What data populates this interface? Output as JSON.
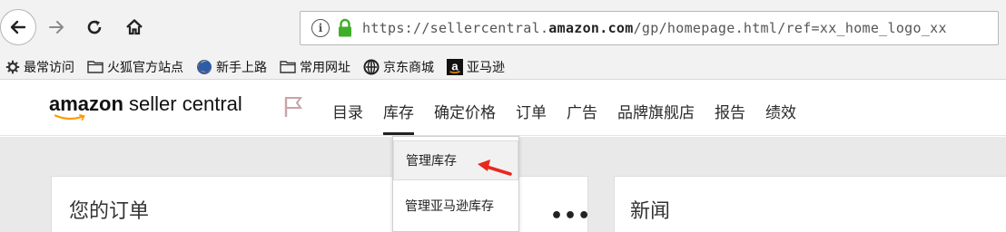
{
  "browser": {
    "url_prefix": "https://sellercentral.",
    "url_domain": "amazon.com",
    "url_suffix": "/gp/homepage.html/ref=xx_home_logo_xx"
  },
  "bookmarks": [
    {
      "label": "最常访问",
      "icon": "gear-icon"
    },
    {
      "label": "火狐官方站点",
      "icon": "folder-icon"
    },
    {
      "label": "新手上路",
      "icon": "firefox-icon"
    },
    {
      "label": "常用网址",
      "icon": "folder-icon"
    },
    {
      "label": "京东商城",
      "icon": "jd-icon"
    },
    {
      "label": "亚马逊",
      "icon": "amazon-icon"
    }
  ],
  "header": {
    "logo_brand": "amazon",
    "logo_product": "seller central",
    "nav": [
      "目录",
      "库存",
      "确定价格",
      "订单",
      "广告",
      "品牌旗舰店",
      "报告",
      "绩效"
    ]
  },
  "dropdown": {
    "items": [
      "管理库存",
      "管理亚马逊库存"
    ]
  },
  "main": {
    "orders_title": "您的订单",
    "more_label": "•••",
    "news_title": "新闻"
  },
  "colors": {
    "accent_orange": "#ff9900",
    "annotation_red": "#e8281f",
    "lock_green": "#3fae29"
  }
}
